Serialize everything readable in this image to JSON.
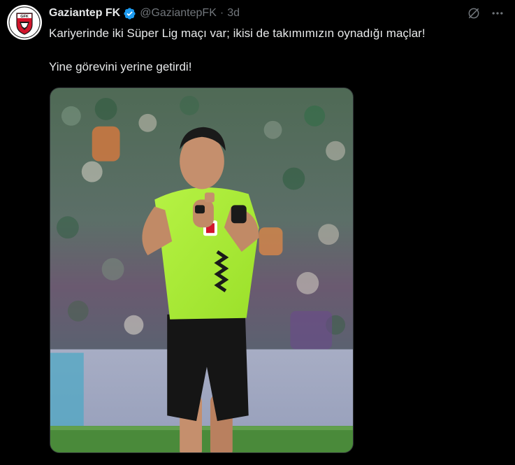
{
  "tweet": {
    "author_name": "Gaziantep FK",
    "handle": "@GaziantepFK",
    "separator": "·",
    "time": "3d",
    "paragraphs": [
      "Kariyerinde iki Süper Lig maçı var; ikisi de takımımızın oynadığı maçlar!",
      "Yine görevini yerine getirdi!"
    ],
    "avatar_logo_text": "GFK",
    "icons": [
      "verified-badge-icon",
      "grok-icon",
      "more-icon"
    ],
    "colors": {
      "background": "#000000",
      "text": "#e7e9ea",
      "muted": "#71767b",
      "verified": "#1d9bf0",
      "brand_red": "#d2142b"
    }
  }
}
